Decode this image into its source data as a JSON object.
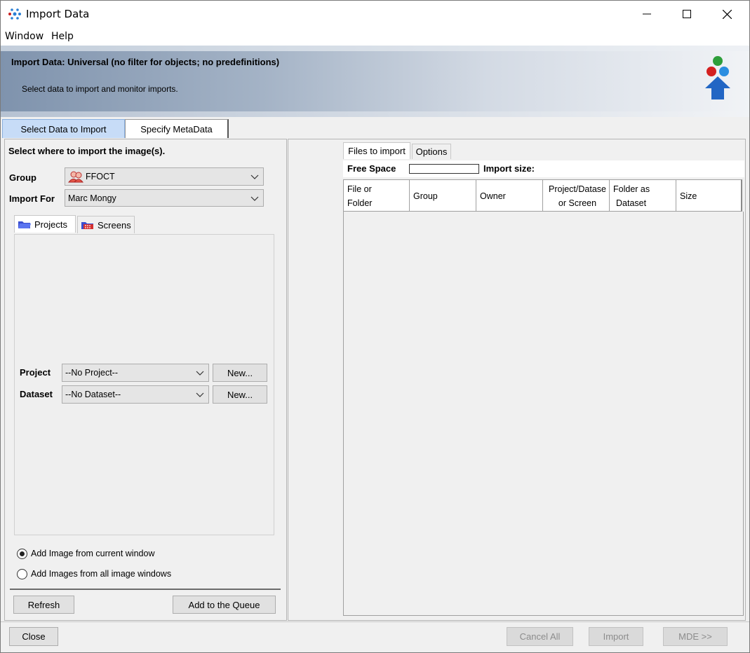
{
  "window": {
    "title": "Import Data",
    "controls": {
      "minimize": "—",
      "maximize": "☐",
      "close": "✕"
    }
  },
  "menu": {
    "items": [
      "Window",
      "Help"
    ]
  },
  "banner": {
    "title": "Import Data: Universal (no filter for objects; no predefinitions)",
    "subtitle": "Select data to import and monitor imports."
  },
  "main_tabs": [
    "Select Data to Import",
    "Specify MetaData"
  ],
  "left": {
    "heading": "Select where to import the image(s).",
    "group_label": "Group",
    "group_value": "FFOCT",
    "import_for_label": "Import For",
    "import_for_value": "Marc Mongy",
    "sub_tabs": [
      "Projects",
      "Screens"
    ],
    "project_label": "Project",
    "project_value": "--No Project--",
    "dataset_label": "Dataset",
    "dataset_value": "--No Dataset--",
    "new_label": "New...",
    "radio_options": [
      {
        "label": "Add Image from current window",
        "selected": true
      },
      {
        "label": "Add Images from all image windows",
        "selected": false
      }
    ],
    "refresh_label": "Refresh",
    "add_queue_label": "Add to the Queue"
  },
  "right": {
    "tabs": [
      "Files to import",
      "Options"
    ],
    "free_space_label": "Free Space",
    "import_size_label": "Import size:",
    "columns": [
      {
        "line1": "File or",
        "line2": "Folder"
      },
      {
        "line1": "Group",
        "line2": ""
      },
      {
        "line1": "Owner",
        "line2": ""
      },
      {
        "line1": "Project/Datase",
        "line2": "or Screen"
      },
      {
        "line1": "Folder as",
        "line2": "Dataset"
      },
      {
        "line1": "Size",
        "line2": ""
      }
    ]
  },
  "bottom": {
    "close_label": "Close",
    "cancel_all_label": "Cancel All",
    "import_label": "Import",
    "mde_label": "MDE >>"
  },
  "colors": {
    "active_tab": "#c7dcf7",
    "banner_dark": "#7f93ad",
    "disabled_text": "#8c8c8c"
  }
}
